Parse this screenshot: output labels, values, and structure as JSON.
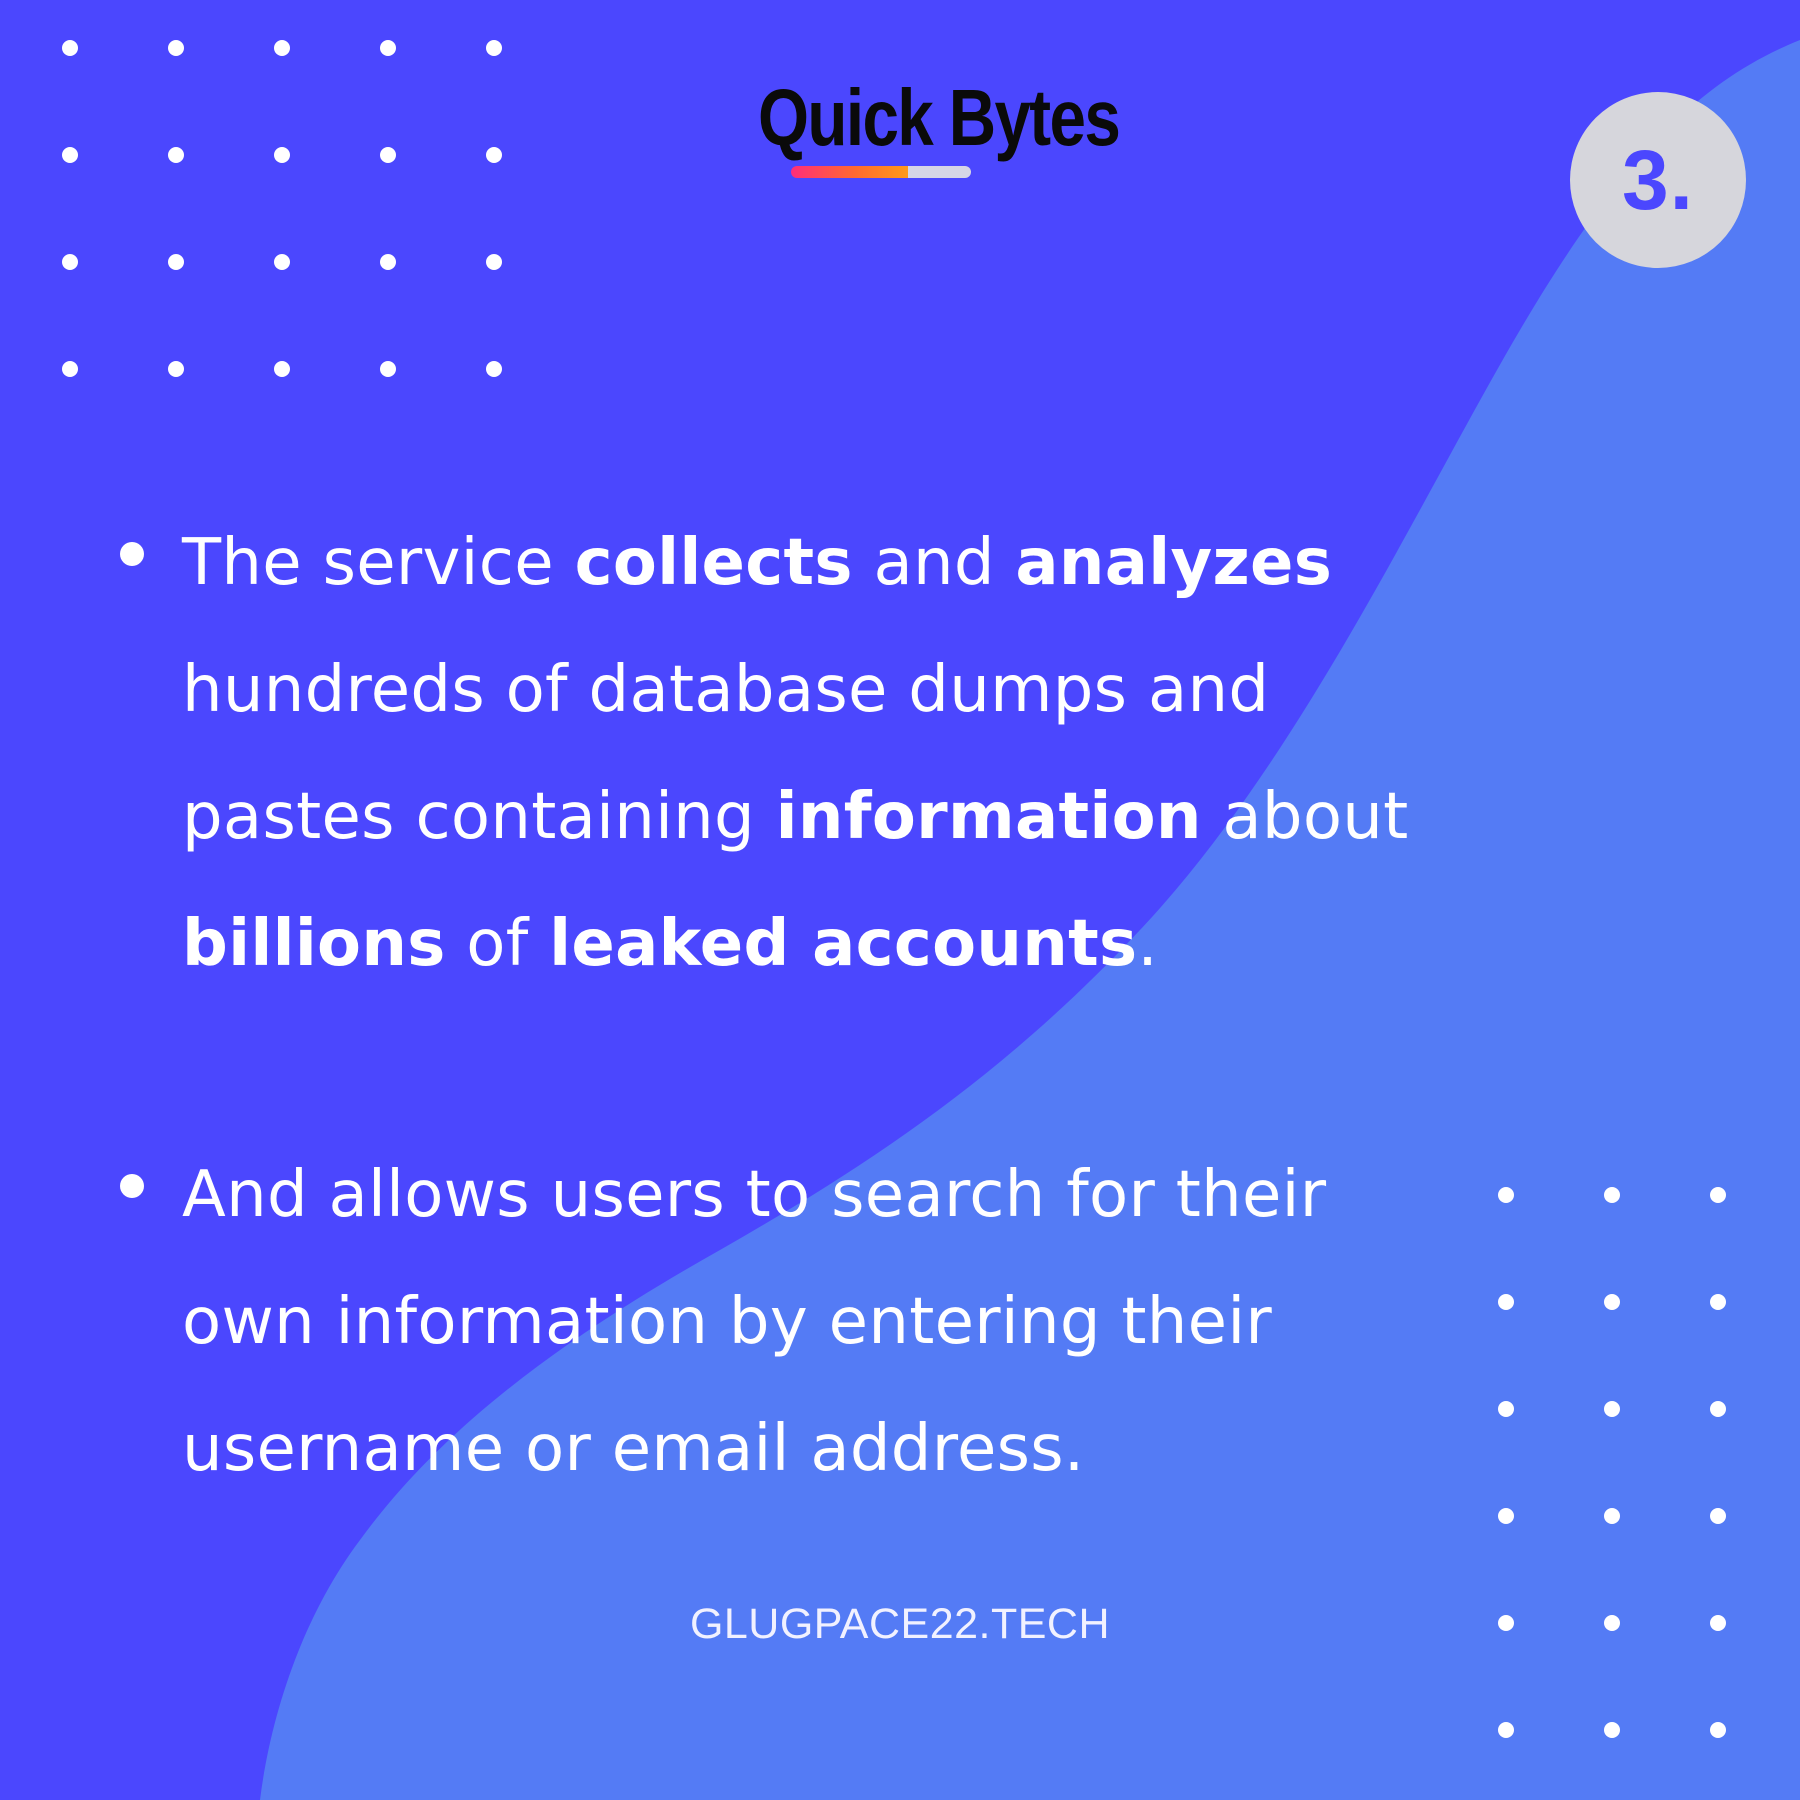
{
  "brand": {
    "title": "Quick Bytes"
  },
  "step": {
    "label": "3."
  },
  "bullets": [
    {
      "lines": [
        [
          {
            "text": "The service ",
            "bold": false
          },
          {
            "text": "collects",
            "bold": true
          },
          {
            "text": " and ",
            "bold": false
          },
          {
            "text": "analyzes",
            "bold": true
          }
        ],
        [
          {
            "text": "hundreds of database dumps and",
            "bold": false
          }
        ],
        [
          {
            "text": "pastes containing ",
            "bold": false
          },
          {
            "text": "information",
            "bold": true
          },
          {
            "text": " about",
            "bold": false
          }
        ],
        [
          {
            "text": "billions",
            "bold": true
          },
          {
            "text": " of ",
            "bold": false
          },
          {
            "text": "leaked accounts",
            "bold": true
          },
          {
            "text": ".",
            "bold": false
          }
        ]
      ]
    },
    {
      "lines": [
        [
          {
            "text": " And allows users to search for their",
            "bold": false
          }
        ],
        [
          {
            "text": "own information by entering their",
            "bold": false
          }
        ],
        [
          {
            "text": "username or email address.",
            "bold": false
          }
        ]
      ]
    }
  ],
  "footer": {
    "site": "GLUGPACE22.TECH"
  },
  "colors": {
    "background": "#4b47fe",
    "wave": "#547bf5",
    "badge": "#d6d6dc",
    "badge_text": "#4b47fe",
    "text": "#ffffff",
    "title": "#0a0a0a"
  }
}
